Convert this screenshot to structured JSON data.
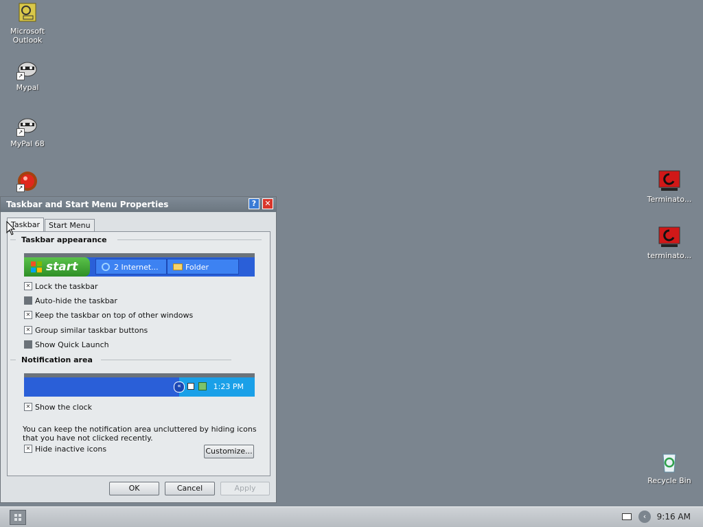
{
  "desktop": {
    "icons": [
      {
        "label": "Microsoft Outlook"
      },
      {
        "label": "Mypal"
      },
      {
        "label": "MyPal 68"
      },
      {
        "label": ""
      },
      {
        "label": "Terminato..."
      },
      {
        "label": "terminato..."
      },
      {
        "label": "Recycle Bin"
      }
    ]
  },
  "dialog": {
    "title": "Taskbar and Start Menu Properties",
    "help_btn": "?",
    "close_btn": "✕",
    "tabs": [
      {
        "label": "Taskbar"
      },
      {
        "label": "Start Menu"
      }
    ],
    "taskbar_appearance": {
      "heading": "Taskbar appearance",
      "start_label": "start",
      "task_buttons": [
        "2 Internet...",
        "Folder"
      ],
      "options": [
        {
          "label": "Lock the taskbar",
          "checked": true
        },
        {
          "label": "Auto-hide the taskbar",
          "checked": false
        },
        {
          "label": "Keep the taskbar on top of other windows",
          "checked": true
        },
        {
          "label": "Group similar taskbar buttons",
          "checked": true
        },
        {
          "label": "Show Quick Launch",
          "checked": false
        }
      ]
    },
    "notification_area": {
      "heading": "Notification area",
      "clock": "1:23 PM",
      "show_clock": {
        "label": "Show the clock",
        "checked": true
      },
      "info": "You can keep the notification area uncluttered by hiding icons that you have not clicked recently.",
      "hide_inactive": {
        "label": "Hide inactive icons",
        "checked": true
      },
      "customize_label": "Customize..."
    },
    "buttons": {
      "ok": "OK",
      "cancel": "Cancel",
      "apply": "Apply"
    }
  },
  "taskbar": {
    "time": "9:16 AM"
  }
}
